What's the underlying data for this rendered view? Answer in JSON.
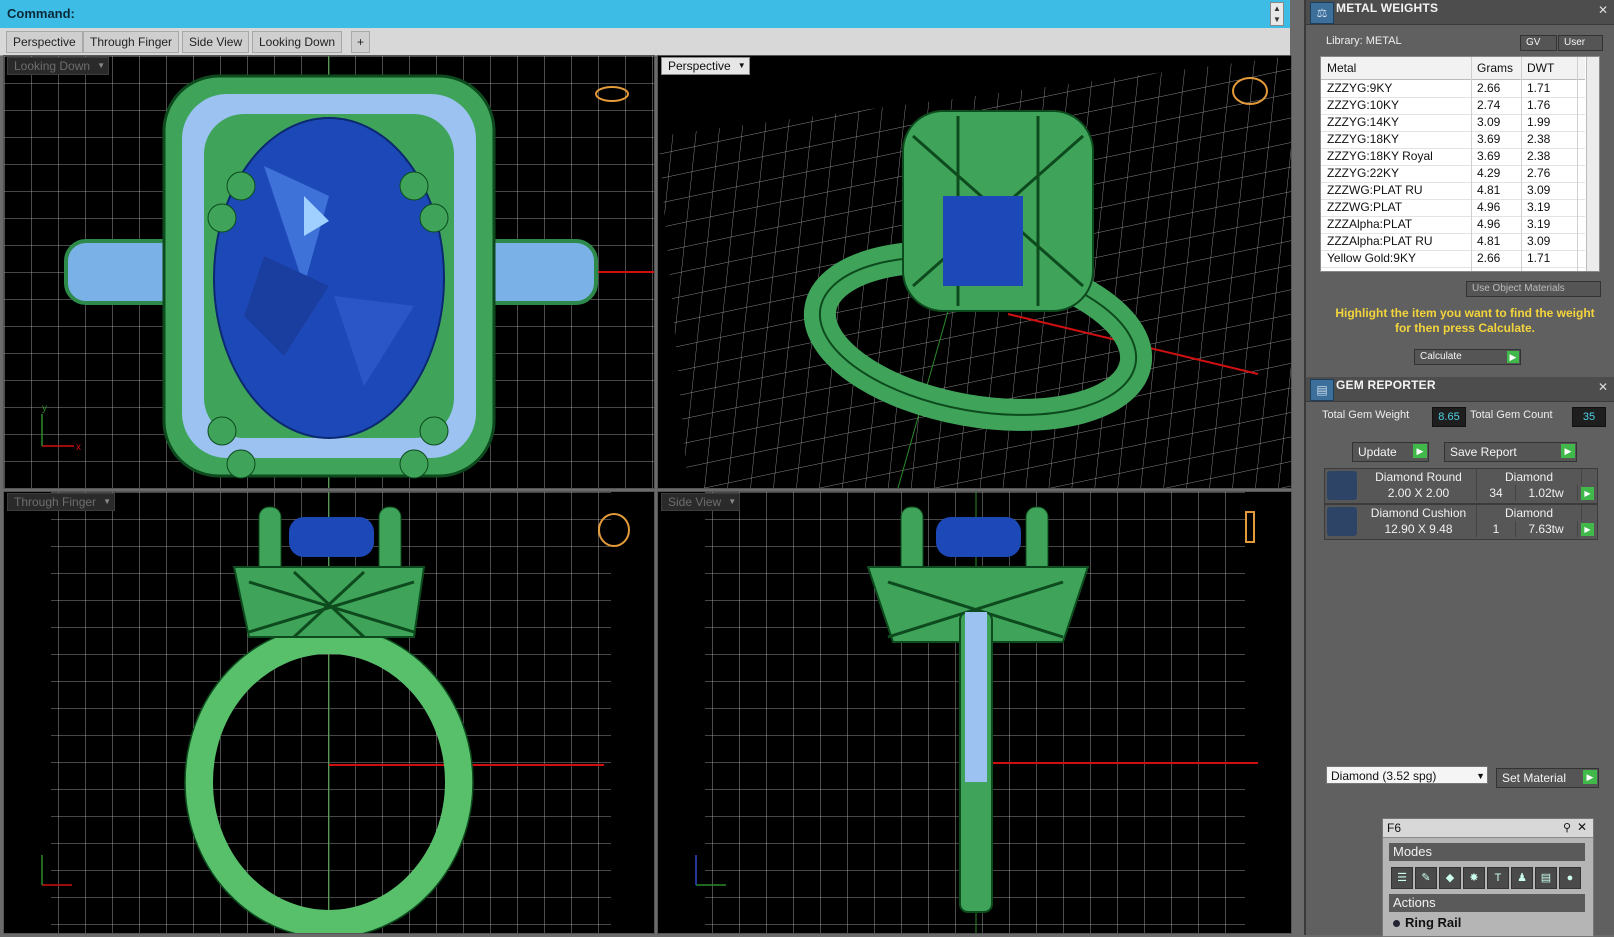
{
  "command": {
    "label": "Command:"
  },
  "view_tabs": [
    "Perspective",
    "Through Finger",
    "Side View",
    "Looking Down"
  ],
  "viewports": {
    "top_left": "Looking Down",
    "top_right": "Perspective",
    "bottom_left": "Through Finger",
    "bottom_right": "Side View"
  },
  "axis": {
    "x": "x",
    "y": "y"
  },
  "metal_weights": {
    "title": "METAL WEIGHTS",
    "library": "Library: METAL",
    "gv": "GV",
    "user": "User",
    "columns": [
      "Metal",
      "Grams",
      "DWT"
    ],
    "rows": [
      [
        "ZZZYG:9KY",
        "2.66",
        "1.71"
      ],
      [
        "ZZZYG:10KY",
        "2.74",
        "1.76"
      ],
      [
        "ZZZYG:14KY",
        "3.09",
        "1.99"
      ],
      [
        "ZZZYG:18KY",
        "3.69",
        "2.38"
      ],
      [
        "ZZZYG:18KY Royal",
        "3.69",
        "2.38"
      ],
      [
        "ZZZYG:22KY",
        "4.29",
        "2.76"
      ],
      [
        "ZZZWG:PLAT RU",
        "4.81",
        "3.09"
      ],
      [
        "ZZZWG:PLAT",
        "4.96",
        "3.19"
      ],
      [
        "ZZZAlpha:PLAT",
        "4.96",
        "3.19"
      ],
      [
        "ZZZAlpha:PLAT RU",
        "4.81",
        "3.09"
      ],
      [
        "Yellow Gold:9KY",
        "2.66",
        "1.71"
      ]
    ],
    "use_object_materials": "Use Object Materials",
    "hint": "Highlight the item you want to find the weight for then press Calculate.",
    "calculate": "Calculate"
  },
  "gem_reporter": {
    "title": "GEM REPORTER",
    "total_weight_label": "Total Gem Weight",
    "total_weight": "8.65",
    "total_count_label": "Total Gem Count",
    "total_count": "35",
    "update": "Update",
    "save_report": "Save Report",
    "gems": [
      {
        "name": "Diamond Round",
        "material": "Diamond",
        "size": "2.00 X 2.00",
        "count": "34",
        "weight": "1.02tw"
      },
      {
        "name": "Diamond Cushion",
        "material": "Diamond",
        "size": "12.90 X 9.48",
        "count": "1",
        "weight": "7.63tw"
      }
    ],
    "material_select": "Diamond    (3.52 spg)",
    "set_material": "Set Material"
  },
  "f6": {
    "title": "F6",
    "modes": "Modes",
    "actions": "Actions",
    "ring_rail": "Ring Rail",
    "tools": [
      "list-icon",
      "pen-icon",
      "gem-icon",
      "sparkle-icon",
      "ts-icon",
      "person-icon",
      "doc-icon",
      "sphere-icon"
    ]
  },
  "colors": {
    "command_bar": "#3dbde6",
    "metal": "#3fa45a",
    "gem": "#1d49b8",
    "accent_hint": "#f3d43c"
  }
}
